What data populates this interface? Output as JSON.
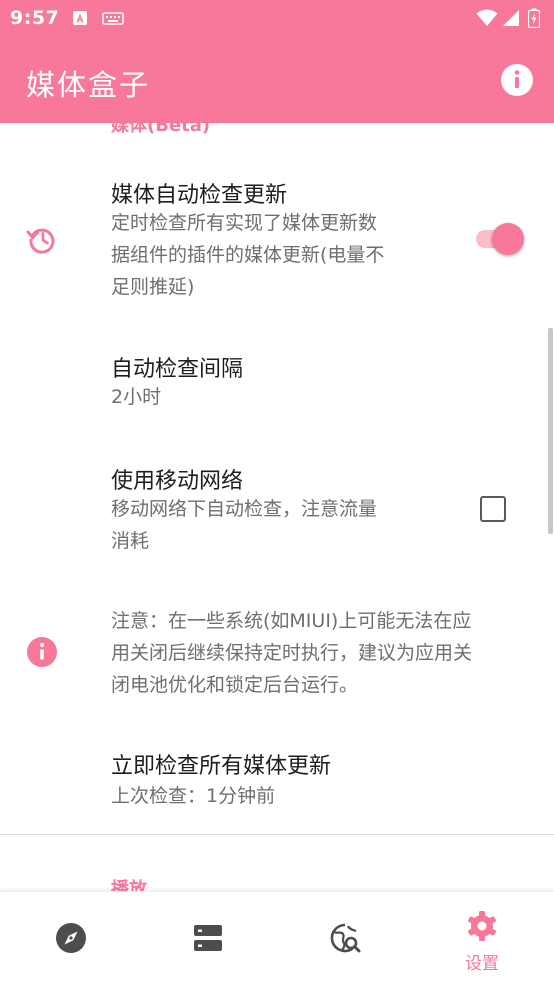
{
  "status_bar": {
    "time": "9:57"
  },
  "app_bar": {
    "title": "媒体盒子",
    "info_icon": "info-icon"
  },
  "content": {
    "category_top": "媒体(Beta)",
    "auto_check": {
      "title": "媒体自动检查更新",
      "summary_lines": [
        "定时检查所有实现了媒体更新数",
        "据组件的插件的媒体更新(电量不",
        "足则推延)"
      ],
      "enabled": true,
      "icon": "history-icon"
    },
    "interval": {
      "title": "自动检查间隔",
      "summary": "2小时"
    },
    "mobile_network": {
      "title": "使用移动网络",
      "summary_lines": [
        "移动网络下自动检查，注意流量",
        "消耗"
      ],
      "checked": false
    },
    "notice": {
      "lines": [
        "注意：在一些系统(如MIUI)上可能无法在应",
        "用关闭后继续保持定时执行，建议为应用关",
        "闭电池优化和锁定后台运行。"
      ],
      "icon": "info-icon"
    },
    "check_now": {
      "title": "立即检查所有媒体更新",
      "summary": "上次检查：1分钟前"
    },
    "category_bottom": "播放"
  },
  "bottom_nav": {
    "items": [
      {
        "icon": "compass-icon",
        "label": ""
      },
      {
        "icon": "storage-icon",
        "label": ""
      },
      {
        "icon": "travel-explore-icon",
        "label": ""
      },
      {
        "icon": "gear-icon",
        "label": "设置",
        "active": true
      }
    ]
  },
  "colors": {
    "accent": "#f87899",
    "track": "#fbbccb",
    "nav_icon": "#4d4d4d"
  }
}
